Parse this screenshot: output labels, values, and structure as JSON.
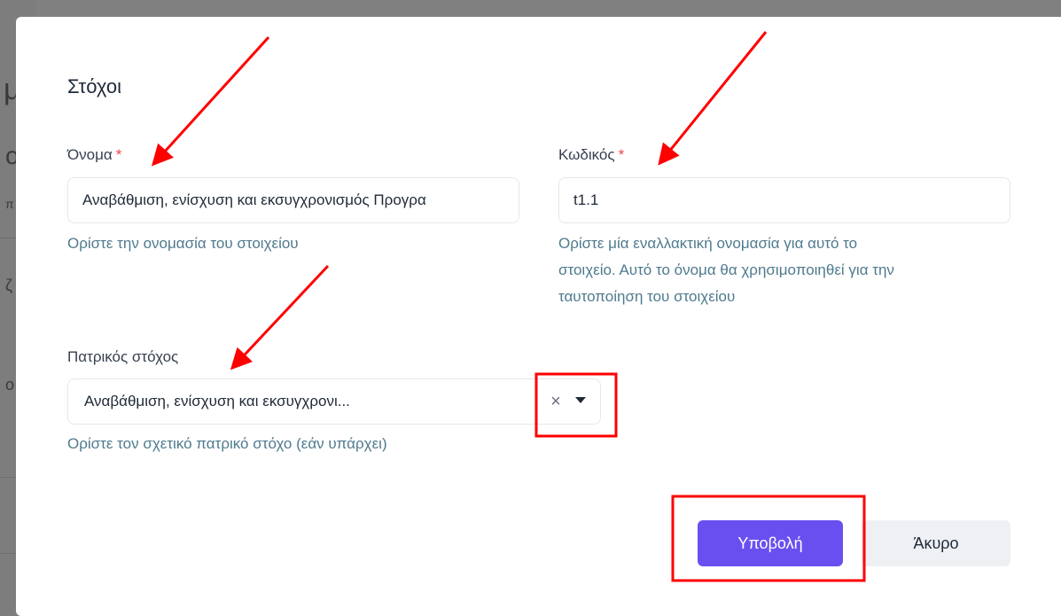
{
  "modal": {
    "title": "Στόχοι"
  },
  "form": {
    "name": {
      "label": "Όνομα",
      "required_mark": "*",
      "value": "Αναβάθμιση, ενίσχυση και εκσυγχρονισμός Προγρα",
      "help": "Ορίστε την ονομασία του στοιχείου"
    },
    "code": {
      "label": "Κωδικός",
      "required_mark": "*",
      "value": "t1.1",
      "help_lines": [
        "Ορίστε μία εναλλακτική ονομασία για αυτό το",
        "στοιχείο. Αυτό το όνομα θα χρησιμοποιηθεί για την",
        "ταυτοποίηση του στοιχείου"
      ]
    },
    "parent_goal": {
      "label": "Πατρικός στόχος",
      "selected": "Αναβάθμιση, ενίσχυση και εκσυγχρονι...",
      "clear_glyph": "×",
      "help": "Ορίστε τον σχετικό πατρικό στόχο (εάν υπάρχει)"
    }
  },
  "actions": {
    "submit_label": "Υποβολή",
    "cancel_label": "Άκυρο"
  },
  "background_glyphs": [
    "μ",
    "ο",
    "π",
    "ζ",
    "ο"
  ],
  "annotation_colors": {
    "arrow": "#ff0000",
    "highlight_box": "#ff0000"
  },
  "colors": {
    "primary": "#6a4ff0",
    "help_text": "#4f7a8e",
    "required": "#ef4444"
  }
}
